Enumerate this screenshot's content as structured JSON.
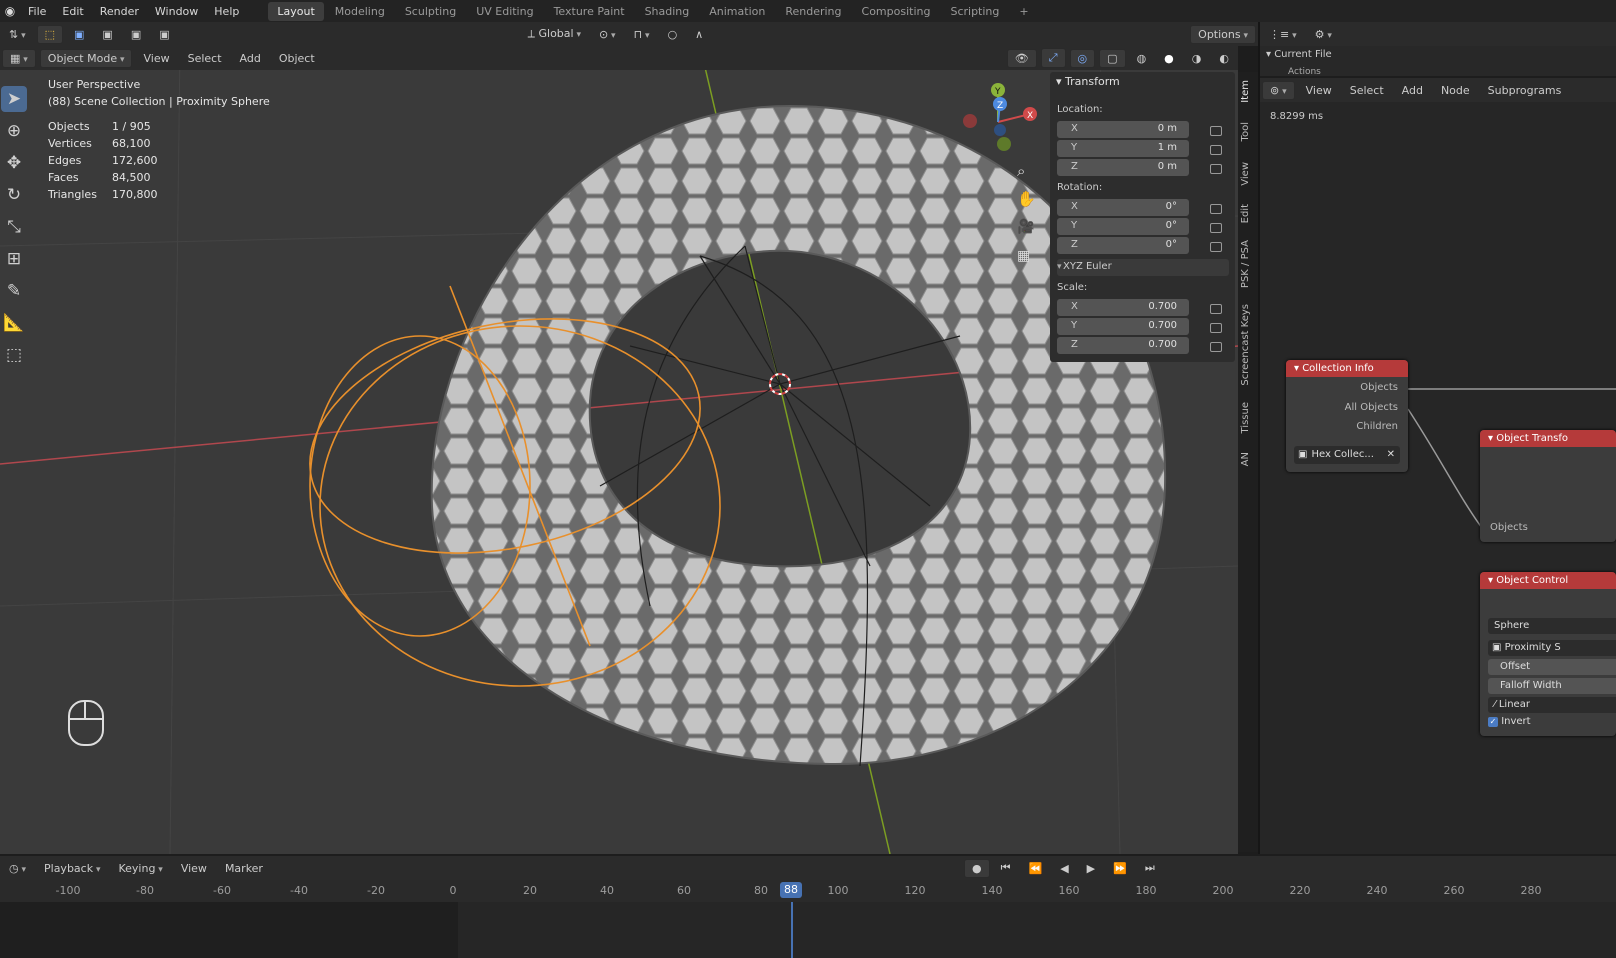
{
  "menubar": {
    "menus": [
      "File",
      "Edit",
      "Render",
      "Window",
      "Help"
    ],
    "workspaces": [
      "Layout",
      "Modeling",
      "Sculpting",
      "UV Editing",
      "Texture Paint",
      "Shading",
      "Animation",
      "Rendering",
      "Compositing",
      "Scripting"
    ],
    "active_workspace": "Layout",
    "add_tab": "+"
  },
  "viewport": {
    "orientation_label": "Global",
    "options_label": "Options",
    "mode_label": "Object Mode",
    "header_menus": [
      "View",
      "Select",
      "Add",
      "Object"
    ],
    "perspective": "User Perspective",
    "collection": "(88) Scene Collection | Proximity Sphere",
    "stats": [
      {
        "label": "Objects",
        "value": "1 / 905"
      },
      {
        "label": "Vertices",
        "value": "68,100"
      },
      {
        "label": "Edges",
        "value": "172,600"
      },
      {
        "label": "Faces",
        "value": "84,500"
      },
      {
        "label": "Triangles",
        "value": "170,800"
      }
    ],
    "gizmo_axes": {
      "x": "X",
      "y": "Y",
      "z": "Z"
    }
  },
  "transform_panel": {
    "title": "Transform",
    "location_label": "Location:",
    "location": [
      {
        "axis": "X",
        "value": "0 m"
      },
      {
        "axis": "Y",
        "value": "1 m"
      },
      {
        "axis": "Z",
        "value": "0 m"
      }
    ],
    "rotation_label": "Rotation:",
    "rotation": [
      {
        "axis": "X",
        "value": "0°"
      },
      {
        "axis": "Y",
        "value": "0°"
      },
      {
        "axis": "Z",
        "value": "0°"
      }
    ],
    "rotation_mode": "XYZ Euler",
    "scale_label": "Scale:",
    "scale": [
      {
        "axis": "X",
        "value": "0.700"
      },
      {
        "axis": "Y",
        "value": "0.700"
      },
      {
        "axis": "Z",
        "value": "0.700"
      }
    ]
  },
  "side_tabs": [
    "Item",
    "Tool",
    "View",
    "Edit",
    "PSK / PSA",
    "Screencast Keys",
    "Tissue",
    "AN"
  ],
  "outliner": {
    "current_file": "Current File",
    "actions": "Actions"
  },
  "node_editor": {
    "menus": [
      "View",
      "Select",
      "Add",
      "Node",
      "Subprograms"
    ],
    "exec_time": "8.8299 ms",
    "collection_info": {
      "title": "Collection Info",
      "outputs": [
        "Objects",
        "All Objects",
        "Children"
      ],
      "collection_value": "Hex Collec..."
    },
    "object_transforms": {
      "title": "Object Transfo",
      "inputs": [
        "Objects"
      ]
    },
    "object_controller": {
      "title": "Object Control",
      "shape": "Sphere",
      "object": "Proximity S",
      "rows": [
        "Offset",
        "Falloff Width",
        "Linear",
        "Invert"
      ]
    }
  },
  "timeline": {
    "menus": [
      "Playback",
      "Keying",
      "View",
      "Marker"
    ],
    "current_frame": "88",
    "ticks": [
      "-100",
      "-80",
      "-60",
      "-40",
      "-20",
      "0",
      "20",
      "40",
      "60",
      "80",
      "100",
      "120",
      "140",
      "160",
      "180",
      "200",
      "220",
      "240",
      "260",
      "280"
    ]
  },
  "colors": {
    "accent": "#4b6a92",
    "node_header": "#b53a3a",
    "selection_orange": "#e8902c",
    "axis_red": "#c0484f",
    "axis_green": "#7c9e22"
  }
}
